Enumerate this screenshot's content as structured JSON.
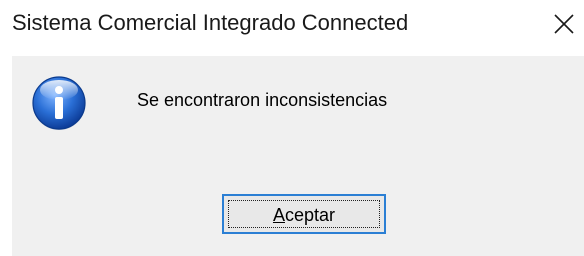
{
  "window": {
    "title": "Sistema Comercial Integrado Connected",
    "close_icon": "close-icon"
  },
  "message": {
    "icon": "info-icon",
    "text": "Se encontraron inconsistencias"
  },
  "buttons": {
    "ok_mnemonic": "A",
    "ok_rest": "ceptar"
  },
  "colors": {
    "focus_border": "#2b7fd4",
    "content_background": "#f0f0f0",
    "icon_blue": "#1e5fc0"
  }
}
